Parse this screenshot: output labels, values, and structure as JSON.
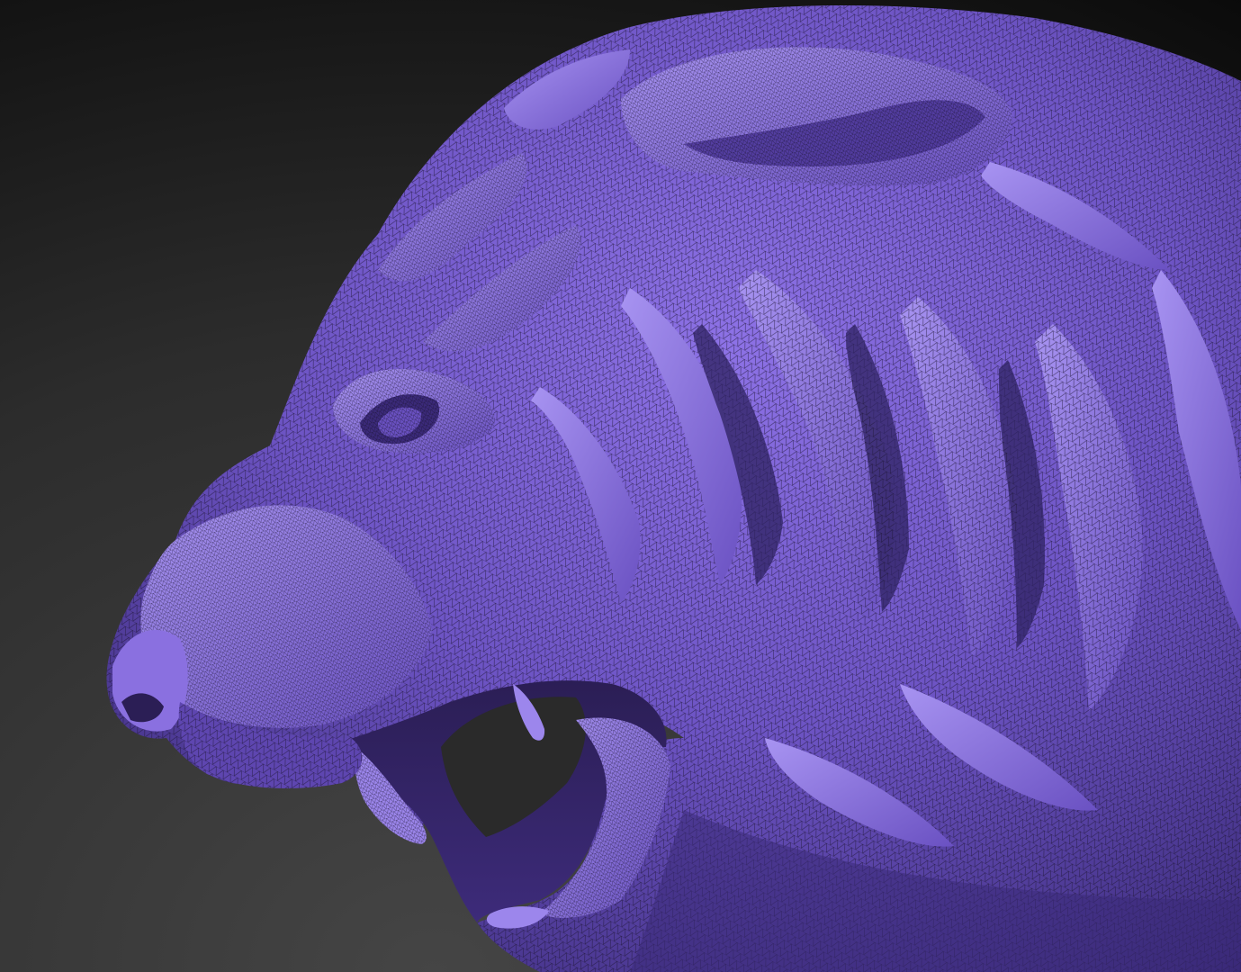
{
  "scene": {
    "subject": "tiger-head-sculpt-wireframe",
    "background_top_color": "#0c0c0c",
    "background_bottom_color": "#3c3c3c",
    "mesh_base_color": "#7a5fd4",
    "mesh_highlight_color": "#a48cf0",
    "mesh_shadow_color": "#2a1d52",
    "wire_color": "#1a1230"
  }
}
